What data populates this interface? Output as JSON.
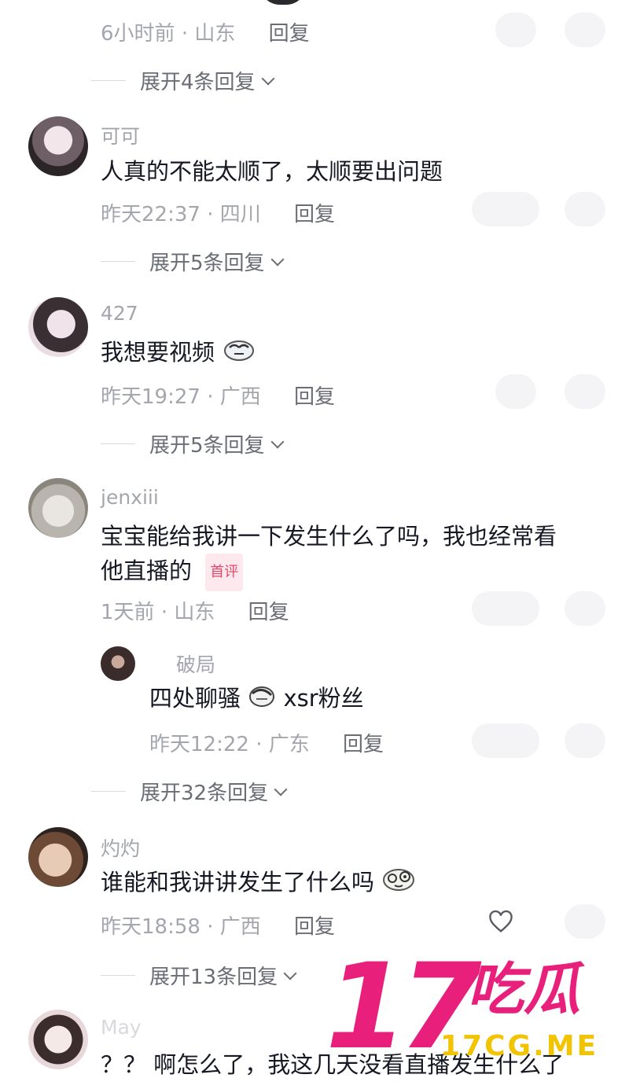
{
  "comments": [
    {
      "meta_time": "6小时前",
      "meta_region": "山东",
      "reply_label": "回复",
      "expand_label": "展开4条回复"
    },
    {
      "name": "可可",
      "text": "人真的不能太顺了，太顺要出问题",
      "meta_time": "昨天22:37",
      "meta_region": "四川",
      "reply_label": "回复",
      "expand_label": "展开5条回复"
    },
    {
      "name": "427",
      "text": "我想要视频",
      "meta_time": "昨天19:27",
      "meta_region": "广西",
      "reply_label": "回复",
      "expand_label": "展开5条回复"
    },
    {
      "name": "jenxiii",
      "text_line1": "宝宝能给我讲一下发生什么了吗，我也经常看",
      "text_line2": "他直播的",
      "badge": "首评",
      "meta_time": "1天前",
      "meta_region": "山东",
      "reply_label": "回复",
      "expand_label": "展开32条回复",
      "sub_reply": {
        "name": "破局",
        "text_a": "四处聊骚",
        "text_b": "xsr粉丝",
        "meta_time": "昨天12:22",
        "meta_region": "广东",
        "reply_label": "回复"
      }
    },
    {
      "name": "灼灼",
      "text": "谁能和我讲讲发生了什么吗",
      "meta_time": "昨天18:58",
      "meta_region": "广西",
      "reply_label": "回复",
      "expand_label": "展开13条回复"
    },
    {
      "name": "May",
      "text": "？？ 啊怎么了，我这几天没看直播发生什么了"
    }
  ],
  "separator": "·",
  "watermark": {
    "number": "17",
    "chars": "吃瓜",
    "domain": "17CG.ME"
  },
  "colors": {
    "text": "#161823",
    "meta": "#a4a6ad",
    "reply": "#6b6d75",
    "brand": "#e8207c"
  }
}
